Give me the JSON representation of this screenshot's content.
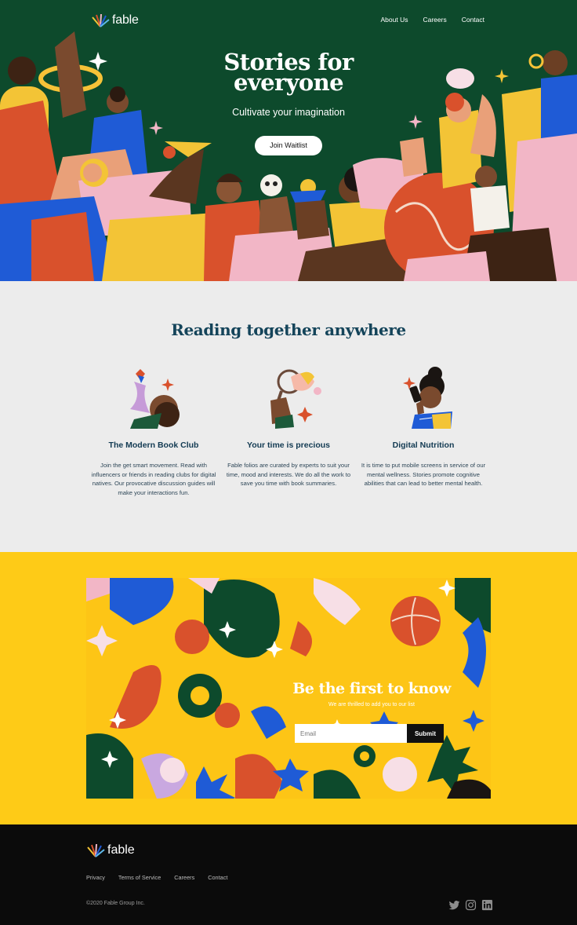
{
  "brand": {
    "name": "fable"
  },
  "nav": {
    "items": [
      "About Us",
      "Careers",
      "Contact"
    ]
  },
  "hero": {
    "title_line1": "Stories for",
    "title_line2": "everyone",
    "subtitle": "Cultivate your imagination",
    "cta": "Join Waitlist"
  },
  "features": {
    "title": "Reading together anywhere",
    "items": [
      {
        "icon": "storyteller-bird-illustration",
        "title": "The Modern Book Club",
        "text": "Join the get smart movement. Read with influencers or friends in reading clubs for digital natives. Our provocative discussion guides will make your interactions fun."
      },
      {
        "icon": "magnifying-glass-illustration",
        "title": "Your time is precious",
        "text": "Fable folios are curated by experts to suit your time, mood and interests. We do all the work to save you time with book summaries."
      },
      {
        "icon": "phone-reader-illustration",
        "title": "Digital Nutrition",
        "text": "It is time to put mobile screens in service of our mental wellness. Stories promote cognitive abilities that can lead to better mental health."
      }
    ]
  },
  "newsletter": {
    "title": "Be the first to know",
    "subtitle": "We are thrilled to add you to our list",
    "email_placeholder": "Email",
    "submit": "Submit"
  },
  "footer": {
    "links": [
      "Privacy",
      "Terms of Service",
      "Careers",
      "Contact"
    ],
    "copyright": "©2020 Fable Group Inc.",
    "social": [
      "twitter-icon",
      "instagram-icon",
      "linkedin-icon"
    ]
  },
  "colors": {
    "hero_green": "#0d4a2c",
    "features_bg": "#ececec",
    "heading_blue": "#14445a",
    "newsletter_yellow": "#fecb17",
    "footer_black": "#0b0b0b",
    "accent_orange": "#d9512c",
    "accent_blue": "#1f5bd6",
    "accent_pink": "#f2b6c6"
  }
}
